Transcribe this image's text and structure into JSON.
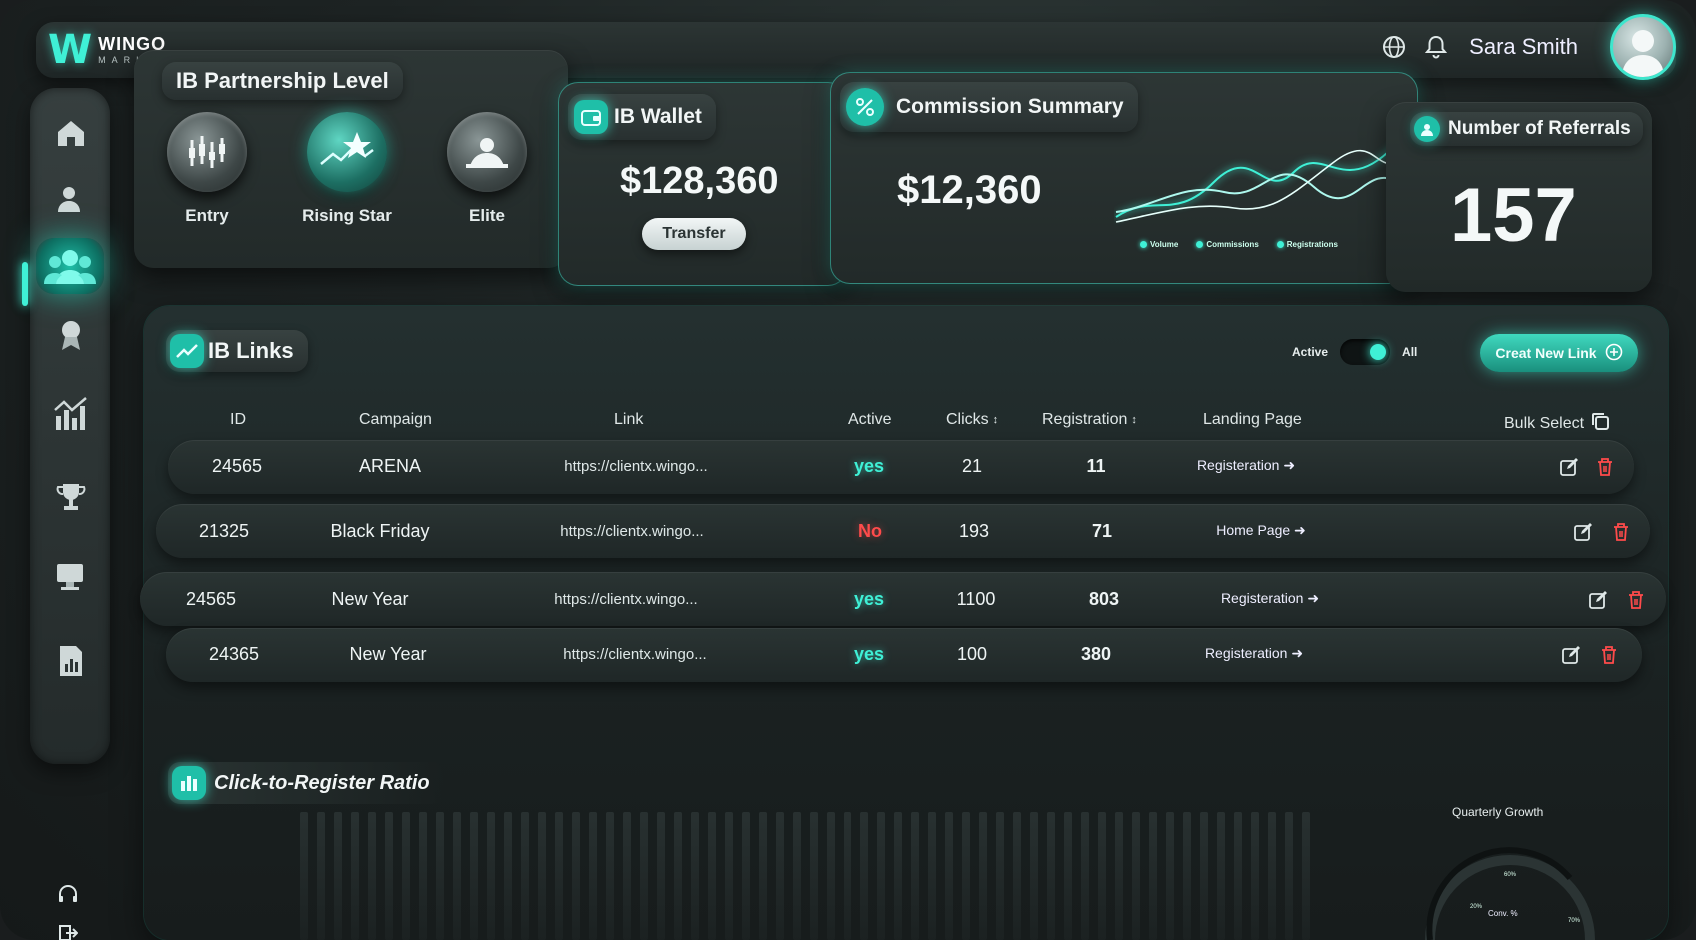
{
  "brand": {
    "name": "WINGO",
    "sub": "MARKETS"
  },
  "header": {
    "user_name": "Sara Smith",
    "icons": [
      "globe-icon",
      "bell-icon"
    ]
  },
  "sidebar": {
    "items": [
      "home-icon",
      "user-icon",
      "group-icon",
      "award-icon",
      "chart-icon",
      "trophy-icon",
      "monitor-icon",
      "report-icon"
    ],
    "active": "group-icon",
    "bottom": [
      "headset-icon",
      "logout-icon"
    ]
  },
  "partnership": {
    "title": "IB Partnership Level",
    "levels": [
      {
        "label": "Entry"
      },
      {
        "label": "Rising Star"
      },
      {
        "label": "Elite"
      }
    ],
    "active": "Rising Star"
  },
  "wallet": {
    "title": "IB Wallet",
    "amount": "$128,360",
    "button": "Transfer"
  },
  "commission": {
    "title": "Commission Summary",
    "amount": "$12,360",
    "legend": [
      "Volume",
      "Commissions",
      "Registrations"
    ]
  },
  "referrals": {
    "title": "Number of Referrals",
    "count": "157"
  },
  "links": {
    "title": "IB Links",
    "toggle": {
      "left": "Active",
      "right": "All"
    },
    "new_button": "Creat New Link",
    "columns": {
      "id": "ID",
      "campaign": "Campaign",
      "link": "Link",
      "active": "Active",
      "clicks": "Clicks",
      "registration": "Registration",
      "landing": "Landing Page",
      "bulk": "Bulk Select"
    },
    "rows": [
      {
        "id": "24565",
        "campaign": "ARENA",
        "link": "https://clientx.wingo...",
        "active": "yes",
        "clicks": "21",
        "registration": "11",
        "landing": "Registeration"
      },
      {
        "id": "21325",
        "campaign": "Black Friday",
        "link": "https://clientx.wingo...",
        "active": "No",
        "clicks": "193",
        "registration": "71",
        "landing": "Home Page"
      },
      {
        "id": "24565",
        "campaign": "New Year",
        "link": "https://clientx.wingo...",
        "active": "yes",
        "clicks": "1100",
        "registration": "803",
        "landing": "Registeration"
      },
      {
        "id": "24365",
        "campaign": "New Year",
        "link": "https://clientx.wingo...",
        "active": "yes",
        "clicks": "100",
        "registration": "380",
        "landing": "Registeration"
      }
    ]
  },
  "ratio": {
    "title": "Click-to-Register Ratio"
  },
  "growth": {
    "title": "Quarterly Growth",
    "center": "Conv. %",
    "ticks": [
      "60%",
      "20%",
      "70%"
    ]
  },
  "colors": {
    "accent": "#3ff0d6",
    "danger": "#ff4b4b",
    "background": "#1a1d1e"
  }
}
